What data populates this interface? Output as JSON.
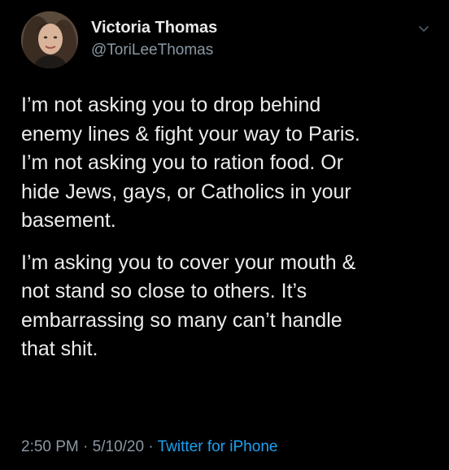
{
  "colors": {
    "background": "#000000",
    "text": "#ececec",
    "secondary_text": "#8b98a5",
    "link": "#1da1f2"
  },
  "author": {
    "display_name": "Victoria Thomas",
    "handle": "@ToriLeeThomas",
    "avatar_icon": "profile-photo"
  },
  "menu_icon": "chevron-down-icon",
  "tweet": {
    "paragraphs": [
      "I’m not asking you to drop behind\nenemy lines & fight your way to Paris.\nI’m not asking you to ration food. Or\nhide Jews, gays, or Catholics in your\nbasement.",
      "I’m asking you to cover your mouth &\nnot stand so close to others. It’s\nembarrassing so many can’t handle\nthat shit."
    ]
  },
  "meta": {
    "time": "2:50 PM",
    "separator": " · ",
    "date": "5/10/20",
    "source": "Twitter for iPhone"
  }
}
